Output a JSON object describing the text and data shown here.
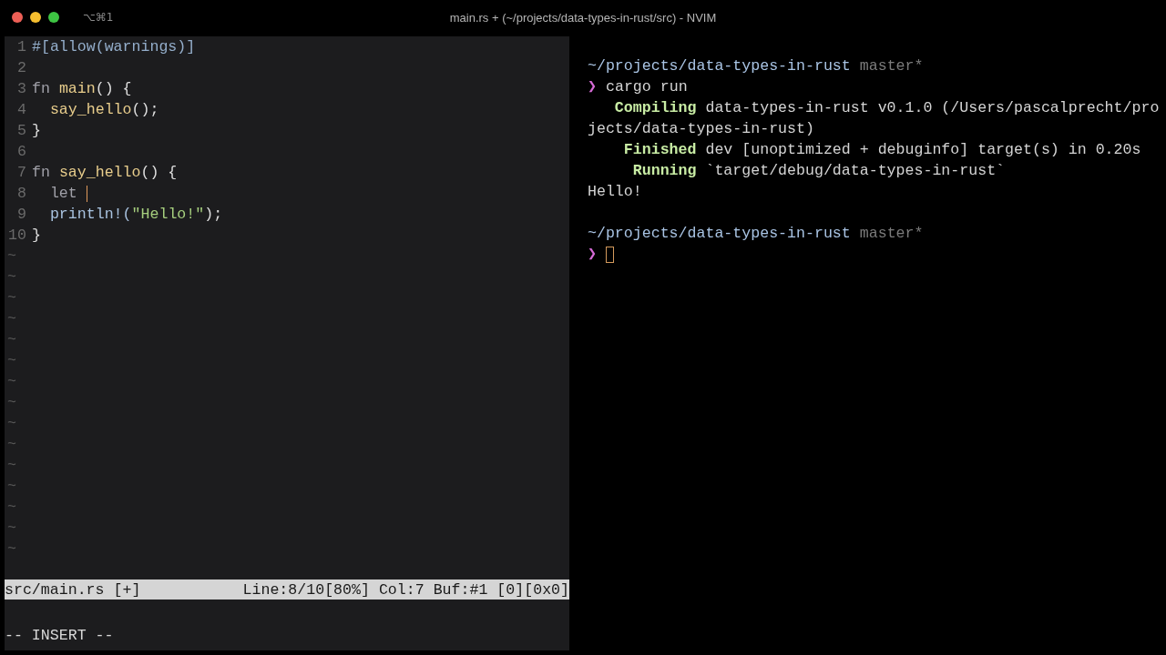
{
  "window": {
    "title": "main.rs + (~/projects/data-types-in-rust/src) - NVIM",
    "shortcut": "⌥⌘1"
  },
  "editor": {
    "lines": [
      {
        "number": "1",
        "cursor": false,
        "tokens": [
          {
            "text": "#[allow(warnings)]",
            "kind": "attr"
          }
        ]
      },
      {
        "number": "2",
        "cursor": false
      },
      {
        "number": "3",
        "cursor": false,
        "tokens": [
          {
            "text": "fn ",
            "kind": "keyword"
          },
          {
            "text": "main",
            "kind": "func"
          },
          {
            "text": "() {",
            "kind": "plain"
          }
        ]
      },
      {
        "number": "4",
        "cursor": false,
        "tokens": [
          {
            "text": "  say_hello",
            "kind": "func"
          },
          {
            "text": "();",
            "kind": "plain"
          }
        ]
      },
      {
        "number": "5",
        "cursor": false,
        "tokens": [
          {
            "text": "}",
            "kind": "plain"
          }
        ]
      },
      {
        "number": "6",
        "cursor": false
      },
      {
        "number": "7",
        "cursor": false,
        "tokens": [
          {
            "text": "fn ",
            "kind": "keyword"
          },
          {
            "text": "say_hello",
            "kind": "func"
          },
          {
            "text": "() {",
            "kind": "plain"
          }
        ]
      },
      {
        "number": "8",
        "cursor": true,
        "tokens": [
          {
            "text": "  let ",
            "kind": "keyword"
          }
        ]
      },
      {
        "number": "9",
        "cursor": false,
        "tokens": [
          {
            "text": "  println!(",
            "kind": "macro"
          },
          {
            "text": "\"Hello!\"",
            "kind": "string"
          },
          {
            "text": ");",
            "kind": "plain"
          }
        ]
      },
      {
        "number": "10",
        "cursor": false,
        "tokens": [
          {
            "text": "}",
            "kind": "plain"
          }
        ]
      }
    ],
    "empty_lines": [
      "~",
      "~",
      "~",
      "~",
      "~",
      "~",
      "~",
      "~",
      "~",
      "~",
      "~",
      "~",
      "~",
      "~",
      "~"
    ],
    "status_bar": {
      "left": "src/main.rs [+]",
      "right": "Line:8/10[80%] Col:7 Buf:#1 [0][0x0]"
    },
    "mode": "-- INSERT --"
  },
  "terminal": {
    "lines": [
      {
        "kind": "prompt",
        "path": "~/projects/data-types-in-rust",
        "branch": "master*"
      },
      {
        "kind": "command",
        "symbol": "❯",
        "text": "cargo run",
        "cursor": false
      },
      {
        "kind": "status",
        "label": "Compiling",
        "text": "data-types-in-rust v0.1.0 (/Users/pascalprecht/pro"
      },
      {
        "kind": "output",
        "text": "jects/data-types-in-rust)"
      },
      {
        "kind": "status",
        "label": "Finished",
        "text": "dev [unoptimized + debuginfo] target(s) in 0.20s"
      },
      {
        "kind": "status",
        "label": "Running",
        "text": "`target/debug/data-types-in-rust`"
      },
      {
        "kind": "output",
        "text": "Hello!"
      },
      {
        "kind": "blank"
      },
      {
        "kind": "prompt",
        "path": "~/projects/data-types-in-rust",
        "branch": "master*"
      },
      {
        "kind": "command",
        "symbol": "❯",
        "cursor": true
      }
    ]
  }
}
